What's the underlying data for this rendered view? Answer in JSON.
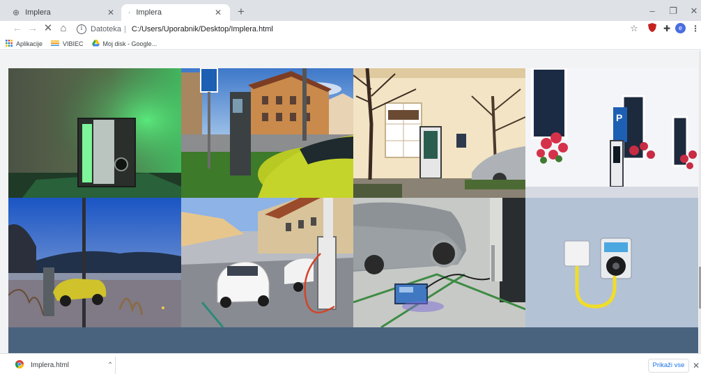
{
  "tabs": [
    {
      "title": "Implera",
      "active": false
    },
    {
      "title": "Implera",
      "active": true
    }
  ],
  "address": {
    "label": "Datoteka",
    "separator": "|",
    "url": "C:/Users/Uporabnik/Desktop/Implera.html"
  },
  "profile_initial": "e",
  "bookmarks": [
    {
      "label": "Aplikacije",
      "icon": "apps-grid-icon"
    },
    {
      "label": "VIBIEC",
      "icon": "vibiec-icon"
    },
    {
      "label": "Moj disk - Google...",
      "icon": "google-drive-icon"
    }
  ],
  "gallery": [
    {
      "subject": "charger-green-light"
    },
    {
      "subject": "charging-station-town"
    },
    {
      "subject": "charging-kiosk-facade"
    },
    {
      "subject": "parking-sign-flowers"
    },
    {
      "subject": "charger-dusk-lake"
    },
    {
      "subject": "charging-street-fiat"
    },
    {
      "subject": "grey-car-test-box"
    },
    {
      "subject": "wallbox-yellow-cable"
    }
  ],
  "download": {
    "filename": "Implera.html",
    "show_all_label": "Prikaži vse"
  },
  "colors": {
    "tabstrip": "#dee1e6",
    "footer": "#49637f",
    "accent": "#1a73e8"
  }
}
